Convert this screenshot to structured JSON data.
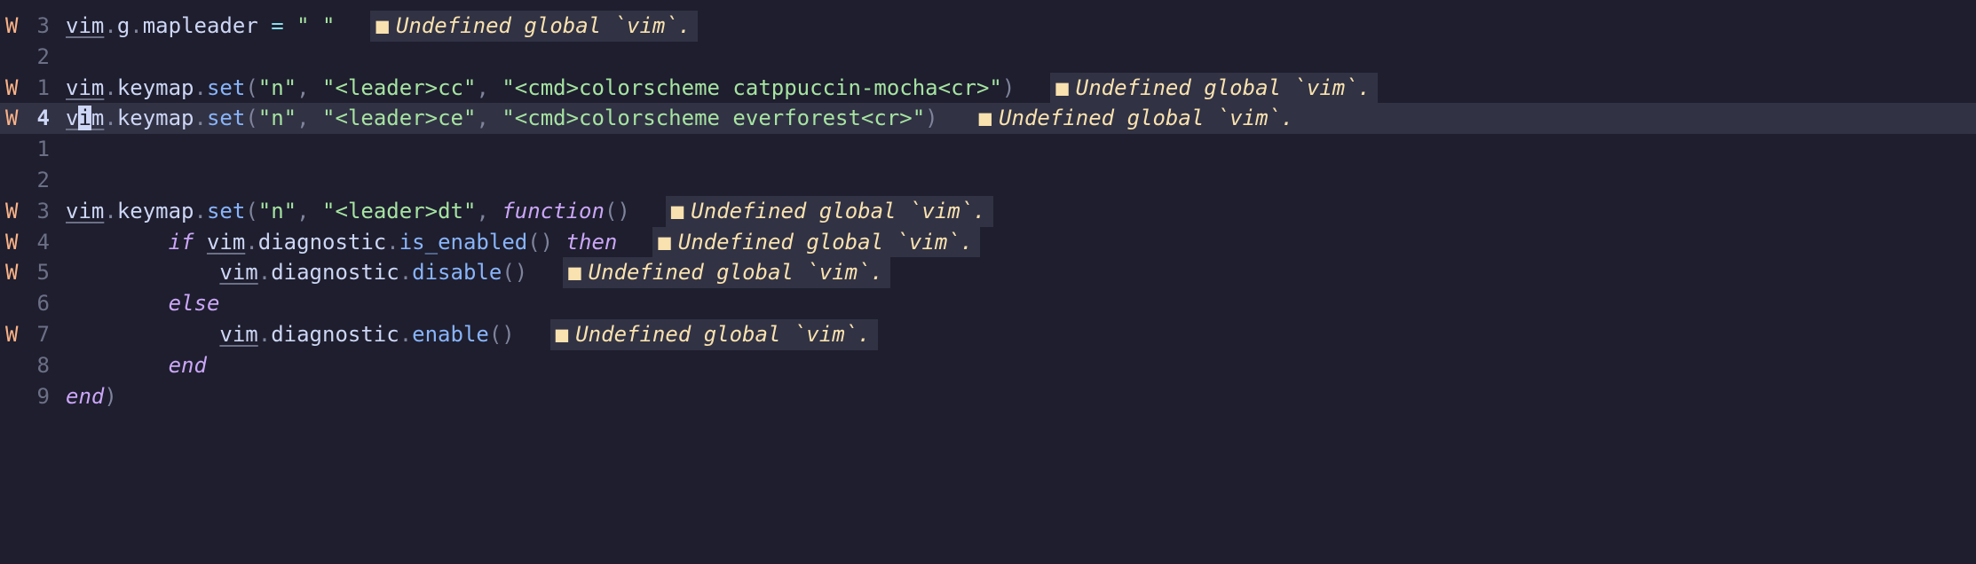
{
  "diag_message": "Undefined global `vim`.",
  "lines": [
    {
      "sign": "W",
      "num": "3",
      "current": false,
      "has_diag": true,
      "tokens": [
        {
          "t": "vim",
          "c": "ident underline"
        },
        {
          "t": ".",
          "c": "punc"
        },
        {
          "t": "g",
          "c": "prop"
        },
        {
          "t": ".",
          "c": "punc"
        },
        {
          "t": "mapleader",
          "c": "prop"
        },
        {
          "t": " ",
          "c": ""
        },
        {
          "t": "=",
          "c": "eq"
        },
        {
          "t": " ",
          "c": ""
        },
        {
          "t": "\" \"",
          "c": "str"
        }
      ]
    },
    {
      "sign": "",
      "num": "2",
      "current": false,
      "has_diag": false,
      "tokens": []
    },
    {
      "sign": "W",
      "num": "1",
      "current": false,
      "has_diag": true,
      "tokens": [
        {
          "t": "vim",
          "c": "ident underline"
        },
        {
          "t": ".",
          "c": "punc"
        },
        {
          "t": "keymap",
          "c": "prop"
        },
        {
          "t": ".",
          "c": "punc"
        },
        {
          "t": "set",
          "c": "func"
        },
        {
          "t": "(",
          "c": "punc"
        },
        {
          "t": "\"n\"",
          "c": "str"
        },
        {
          "t": ", ",
          "c": "punc"
        },
        {
          "t": "\"<leader>cc\"",
          "c": "str"
        },
        {
          "t": ", ",
          "c": "punc"
        },
        {
          "t": "\"<cmd>colorscheme catppuccin-mocha<cr>\"",
          "c": "str"
        },
        {
          "t": ")",
          "c": "punc"
        }
      ]
    },
    {
      "sign": "W",
      "num": "4",
      "current": true,
      "has_diag": true,
      "tokens": [
        {
          "t": "v",
          "c": "ident underline"
        },
        {
          "t": "i",
          "c": "ident cursor"
        },
        {
          "t": "m",
          "c": "ident underline"
        },
        {
          "t": ".",
          "c": "punc"
        },
        {
          "t": "keymap",
          "c": "prop"
        },
        {
          "t": ".",
          "c": "punc"
        },
        {
          "t": "set",
          "c": "func"
        },
        {
          "t": "(",
          "c": "punc"
        },
        {
          "t": "\"n\"",
          "c": "str"
        },
        {
          "t": ", ",
          "c": "punc"
        },
        {
          "t": "\"<leader>ce\"",
          "c": "str"
        },
        {
          "t": ", ",
          "c": "punc"
        },
        {
          "t": "\"<cmd>colorscheme everforest<cr>\"",
          "c": "str"
        },
        {
          "t": ")",
          "c": "punc"
        }
      ]
    },
    {
      "sign": "",
      "num": "1",
      "current": false,
      "has_diag": false,
      "tokens": []
    },
    {
      "sign": "",
      "num": "2",
      "current": false,
      "has_diag": false,
      "tokens": []
    },
    {
      "sign": "W",
      "num": "3",
      "current": false,
      "has_diag": true,
      "tokens": [
        {
          "t": "vim",
          "c": "ident underline"
        },
        {
          "t": ".",
          "c": "punc"
        },
        {
          "t": "keymap",
          "c": "prop"
        },
        {
          "t": ".",
          "c": "punc"
        },
        {
          "t": "set",
          "c": "func"
        },
        {
          "t": "(",
          "c": "punc"
        },
        {
          "t": "\"n\"",
          "c": "str"
        },
        {
          "t": ", ",
          "c": "punc"
        },
        {
          "t": "\"<leader>dt\"",
          "c": "str"
        },
        {
          "t": ", ",
          "c": "punc"
        },
        {
          "t": "function",
          "c": "kw"
        },
        {
          "t": "()",
          "c": "punc"
        }
      ]
    },
    {
      "sign": "W",
      "num": "4",
      "current": false,
      "has_diag": true,
      "tokens": [
        {
          "t": "        ",
          "c": ""
        },
        {
          "t": "if",
          "c": "kw"
        },
        {
          "t": " ",
          "c": ""
        },
        {
          "t": "vim",
          "c": "ident underline"
        },
        {
          "t": ".",
          "c": "punc"
        },
        {
          "t": "diagnostic",
          "c": "prop"
        },
        {
          "t": ".",
          "c": "punc"
        },
        {
          "t": "is_enabled",
          "c": "func"
        },
        {
          "t": "()",
          "c": "punc"
        },
        {
          "t": " ",
          "c": ""
        },
        {
          "t": "then",
          "c": "kw"
        }
      ]
    },
    {
      "sign": "W",
      "num": "5",
      "current": false,
      "has_diag": true,
      "tokens": [
        {
          "t": "            ",
          "c": ""
        },
        {
          "t": "vim",
          "c": "ident underline"
        },
        {
          "t": ".",
          "c": "punc"
        },
        {
          "t": "diagnostic",
          "c": "prop"
        },
        {
          "t": ".",
          "c": "punc"
        },
        {
          "t": "disable",
          "c": "func"
        },
        {
          "t": "()",
          "c": "punc"
        }
      ]
    },
    {
      "sign": "",
      "num": "6",
      "current": false,
      "has_diag": false,
      "tokens": [
        {
          "t": "        ",
          "c": ""
        },
        {
          "t": "else",
          "c": "kw"
        }
      ]
    },
    {
      "sign": "W",
      "num": "7",
      "current": false,
      "has_diag": true,
      "tokens": [
        {
          "t": "            ",
          "c": ""
        },
        {
          "t": "vim",
          "c": "ident underline"
        },
        {
          "t": ".",
          "c": "punc"
        },
        {
          "t": "diagnostic",
          "c": "prop"
        },
        {
          "t": ".",
          "c": "punc"
        },
        {
          "t": "enable",
          "c": "func"
        },
        {
          "t": "()",
          "c": "punc"
        }
      ]
    },
    {
      "sign": "",
      "num": "8",
      "current": false,
      "has_diag": false,
      "tokens": [
        {
          "t": "        ",
          "c": ""
        },
        {
          "t": "end",
          "c": "kw"
        }
      ]
    },
    {
      "sign": "",
      "num": "9",
      "current": false,
      "has_diag": false,
      "tokens": [
        {
          "t": "end",
          "c": "kw"
        },
        {
          "t": ")",
          "c": "punc"
        }
      ]
    }
  ]
}
